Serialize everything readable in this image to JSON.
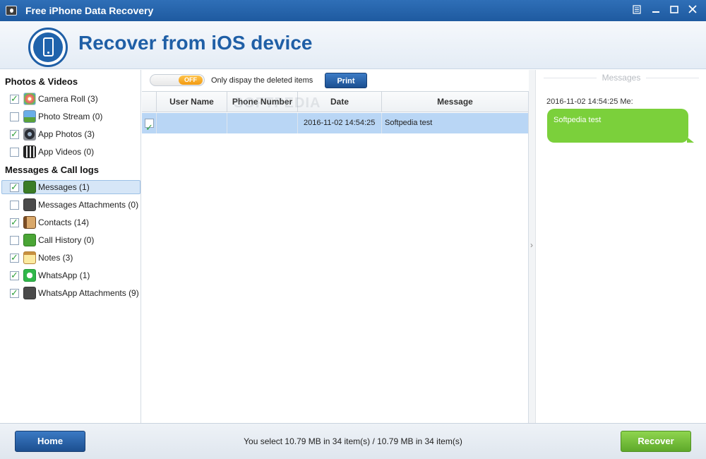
{
  "window": {
    "title": "Free iPhone Data Recovery"
  },
  "header": {
    "heading": "Recover from iOS device"
  },
  "sidebar": {
    "sections": [
      {
        "title": "Photos & Videos",
        "items": [
          {
            "label": "Camera Roll (3)",
            "checked": true,
            "icon": "camera-roll-icon"
          },
          {
            "label": "Photo Stream (0)",
            "checked": false,
            "icon": "photo-stream-icon"
          },
          {
            "label": "App Photos (3)",
            "checked": true,
            "icon": "app-photos-icon"
          },
          {
            "label": "App Videos (0)",
            "checked": false,
            "icon": "app-videos-icon"
          }
        ]
      },
      {
        "title": "Messages & Call logs",
        "items": [
          {
            "label": "Messages (1)",
            "checked": true,
            "icon": "messages-icon",
            "selected": true
          },
          {
            "label": "Messages Attachments (0)",
            "checked": false,
            "icon": "attachment-icon"
          },
          {
            "label": "Contacts (14)",
            "checked": true,
            "icon": "contacts-icon"
          },
          {
            "label": "Call History (0)",
            "checked": false,
            "icon": "phone-icon"
          },
          {
            "label": "Notes (3)",
            "checked": true,
            "icon": "notes-icon"
          },
          {
            "label": "WhatsApp (1)",
            "checked": true,
            "icon": "whatsapp-icon"
          },
          {
            "label": "WhatsApp Attachments (9)",
            "checked": true,
            "icon": "attachment-icon"
          }
        ]
      }
    ]
  },
  "toolbar": {
    "toggle_state": "OFF",
    "toggle_label": "Only dispay the deleted items",
    "print_label": "Print"
  },
  "table": {
    "columns": [
      "User Name",
      "Phone Number",
      "Date",
      "Message"
    ],
    "rows": [
      {
        "checked": true,
        "user_name": "",
        "phone_number": "",
        "date": "2016-11-02 14:54:25",
        "message": "Softpedia test"
      }
    ],
    "watermark": "SOFTPEDIA"
  },
  "preview": {
    "title": "Messages",
    "meta": "2016-11-02 14:54:25 Me:",
    "bubble_text": "Softpedia test"
  },
  "footer": {
    "home_label": "Home",
    "status": "You select 10.79 MB in 34 item(s) / 10.79 MB in 34 item(s)",
    "recover_label": "Recover"
  },
  "colors": {
    "brand_blue": "#1f5fa6",
    "recover_green": "#6cbb32",
    "bubble_green": "#7bd03b",
    "selection": "#b9d6f5"
  }
}
